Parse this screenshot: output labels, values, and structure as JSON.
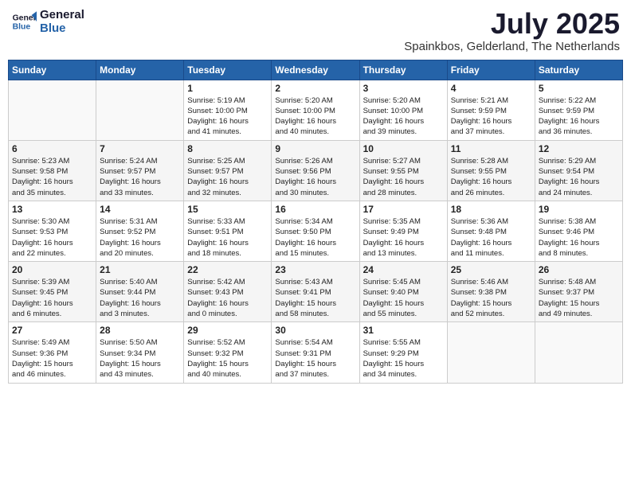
{
  "logo": {
    "line1": "General",
    "line2": "Blue"
  },
  "title": "July 2025",
  "subtitle": "Spainkbos, Gelderland, The Netherlands",
  "weekdays": [
    "Sunday",
    "Monday",
    "Tuesday",
    "Wednesday",
    "Thursday",
    "Friday",
    "Saturday"
  ],
  "weeks": [
    [
      {
        "day": "",
        "info": ""
      },
      {
        "day": "",
        "info": ""
      },
      {
        "day": "1",
        "info": "Sunrise: 5:19 AM\nSunset: 10:00 PM\nDaylight: 16 hours\nand 41 minutes."
      },
      {
        "day": "2",
        "info": "Sunrise: 5:20 AM\nSunset: 10:00 PM\nDaylight: 16 hours\nand 40 minutes."
      },
      {
        "day": "3",
        "info": "Sunrise: 5:20 AM\nSunset: 10:00 PM\nDaylight: 16 hours\nand 39 minutes."
      },
      {
        "day": "4",
        "info": "Sunrise: 5:21 AM\nSunset: 9:59 PM\nDaylight: 16 hours\nand 37 minutes."
      },
      {
        "day": "5",
        "info": "Sunrise: 5:22 AM\nSunset: 9:59 PM\nDaylight: 16 hours\nand 36 minutes."
      }
    ],
    [
      {
        "day": "6",
        "info": "Sunrise: 5:23 AM\nSunset: 9:58 PM\nDaylight: 16 hours\nand 35 minutes."
      },
      {
        "day": "7",
        "info": "Sunrise: 5:24 AM\nSunset: 9:57 PM\nDaylight: 16 hours\nand 33 minutes."
      },
      {
        "day": "8",
        "info": "Sunrise: 5:25 AM\nSunset: 9:57 PM\nDaylight: 16 hours\nand 32 minutes."
      },
      {
        "day": "9",
        "info": "Sunrise: 5:26 AM\nSunset: 9:56 PM\nDaylight: 16 hours\nand 30 minutes."
      },
      {
        "day": "10",
        "info": "Sunrise: 5:27 AM\nSunset: 9:55 PM\nDaylight: 16 hours\nand 28 minutes."
      },
      {
        "day": "11",
        "info": "Sunrise: 5:28 AM\nSunset: 9:55 PM\nDaylight: 16 hours\nand 26 minutes."
      },
      {
        "day": "12",
        "info": "Sunrise: 5:29 AM\nSunset: 9:54 PM\nDaylight: 16 hours\nand 24 minutes."
      }
    ],
    [
      {
        "day": "13",
        "info": "Sunrise: 5:30 AM\nSunset: 9:53 PM\nDaylight: 16 hours\nand 22 minutes."
      },
      {
        "day": "14",
        "info": "Sunrise: 5:31 AM\nSunset: 9:52 PM\nDaylight: 16 hours\nand 20 minutes."
      },
      {
        "day": "15",
        "info": "Sunrise: 5:33 AM\nSunset: 9:51 PM\nDaylight: 16 hours\nand 18 minutes."
      },
      {
        "day": "16",
        "info": "Sunrise: 5:34 AM\nSunset: 9:50 PM\nDaylight: 16 hours\nand 15 minutes."
      },
      {
        "day": "17",
        "info": "Sunrise: 5:35 AM\nSunset: 9:49 PM\nDaylight: 16 hours\nand 13 minutes."
      },
      {
        "day": "18",
        "info": "Sunrise: 5:36 AM\nSunset: 9:48 PM\nDaylight: 16 hours\nand 11 minutes."
      },
      {
        "day": "19",
        "info": "Sunrise: 5:38 AM\nSunset: 9:46 PM\nDaylight: 16 hours\nand 8 minutes."
      }
    ],
    [
      {
        "day": "20",
        "info": "Sunrise: 5:39 AM\nSunset: 9:45 PM\nDaylight: 16 hours\nand 6 minutes."
      },
      {
        "day": "21",
        "info": "Sunrise: 5:40 AM\nSunset: 9:44 PM\nDaylight: 16 hours\nand 3 minutes."
      },
      {
        "day": "22",
        "info": "Sunrise: 5:42 AM\nSunset: 9:43 PM\nDaylight: 16 hours\nand 0 minutes."
      },
      {
        "day": "23",
        "info": "Sunrise: 5:43 AM\nSunset: 9:41 PM\nDaylight: 15 hours\nand 58 minutes."
      },
      {
        "day": "24",
        "info": "Sunrise: 5:45 AM\nSunset: 9:40 PM\nDaylight: 15 hours\nand 55 minutes."
      },
      {
        "day": "25",
        "info": "Sunrise: 5:46 AM\nSunset: 9:38 PM\nDaylight: 15 hours\nand 52 minutes."
      },
      {
        "day": "26",
        "info": "Sunrise: 5:48 AM\nSunset: 9:37 PM\nDaylight: 15 hours\nand 49 minutes."
      }
    ],
    [
      {
        "day": "27",
        "info": "Sunrise: 5:49 AM\nSunset: 9:36 PM\nDaylight: 15 hours\nand 46 minutes."
      },
      {
        "day": "28",
        "info": "Sunrise: 5:50 AM\nSunset: 9:34 PM\nDaylight: 15 hours\nand 43 minutes."
      },
      {
        "day": "29",
        "info": "Sunrise: 5:52 AM\nSunset: 9:32 PM\nDaylight: 15 hours\nand 40 minutes."
      },
      {
        "day": "30",
        "info": "Sunrise: 5:54 AM\nSunset: 9:31 PM\nDaylight: 15 hours\nand 37 minutes."
      },
      {
        "day": "31",
        "info": "Sunrise: 5:55 AM\nSunset: 9:29 PM\nDaylight: 15 hours\nand 34 minutes."
      },
      {
        "day": "",
        "info": ""
      },
      {
        "day": "",
        "info": ""
      }
    ]
  ]
}
